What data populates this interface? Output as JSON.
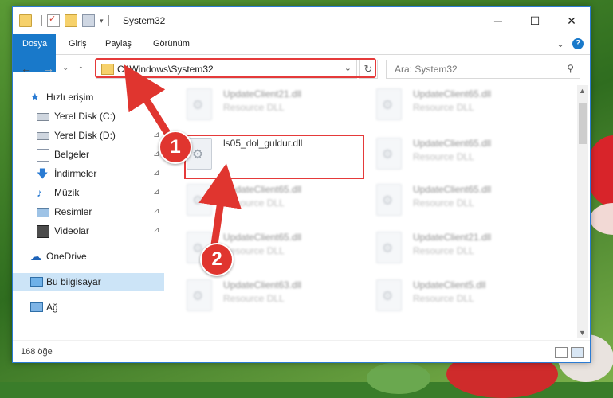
{
  "window": {
    "title": "System32",
    "controls": {
      "minimize": "─",
      "maximize": "☐",
      "close": "✕"
    }
  },
  "ribbon": {
    "tabs": [
      {
        "label": "Dosya"
      },
      {
        "label": "Giriş"
      },
      {
        "label": "Paylaş"
      },
      {
        "label": "Görünüm"
      }
    ],
    "expand_glyph": "⌄",
    "help_glyph": "?"
  },
  "nav": {
    "back_glyph": "←",
    "forward_glyph": "→",
    "recent_glyph": "⌄",
    "up_glyph": "↑",
    "address": "C:\\Windows\\System32",
    "address_dropdown_glyph": "⌄",
    "refresh_glyph": "↻",
    "search_placeholder": "Ara: System32",
    "search_glyph": "⚲"
  },
  "sidebar": {
    "items": [
      {
        "label": "Hızlı erişim",
        "icon": "star-icon",
        "pinned": false
      },
      {
        "label": "Yerel Disk (C:)",
        "icon": "drive-icon",
        "pinned": true
      },
      {
        "label": "Yerel Disk (D:)",
        "icon": "drive-icon",
        "pinned": true
      },
      {
        "label": "Belgeler",
        "icon": "documents-icon",
        "pinned": true
      },
      {
        "label": "İndirmeler",
        "icon": "download-icon",
        "pinned": true
      },
      {
        "label": "Müzik",
        "icon": "music-icon",
        "pinned": true
      },
      {
        "label": "Resimler",
        "icon": "pictures-icon",
        "pinned": true
      },
      {
        "label": "Videolar",
        "icon": "videos-icon",
        "pinned": true
      },
      {
        "label": "OneDrive",
        "icon": "cloud-icon",
        "pinned": false
      },
      {
        "label": "Bu bilgisayar",
        "icon": "computer-icon",
        "pinned": false,
        "selected": true
      },
      {
        "label": "Ağ",
        "icon": "network-icon",
        "pinned": false
      }
    ],
    "pin_glyph": "📌"
  },
  "files": {
    "left_column": [
      {
        "name": "UpdateClient21.dll",
        "type": "Resource DLL"
      },
      {
        "name": "ls05_dol_guldur.dll",
        "type": ""
      },
      {
        "name": "UpdateClient65.dll",
        "type": "Resource DLL"
      },
      {
        "name": "UpdateClient65.dll",
        "type": "Resource DLL"
      },
      {
        "name": "UpdateClient63.dll",
        "type": "Resource DLL"
      }
    ],
    "right_column": [
      {
        "name": "UpdateClient65.dll",
        "type": "Resource DLL"
      },
      {
        "name": "UpdateClient65.dll",
        "type": "Resource DLL"
      },
      {
        "name": "UpdateClient65.dll",
        "type": "Resource DLL"
      },
      {
        "name": "UpdateClient21.dll",
        "type": "Resource DLL"
      },
      {
        "name": "UpdateClient5.dll",
        "type": "Resource DLL"
      }
    ]
  },
  "status": {
    "item_count": "168 öğe"
  },
  "annotations": {
    "step1": "1",
    "step2": "2",
    "color": "#e0352f"
  }
}
